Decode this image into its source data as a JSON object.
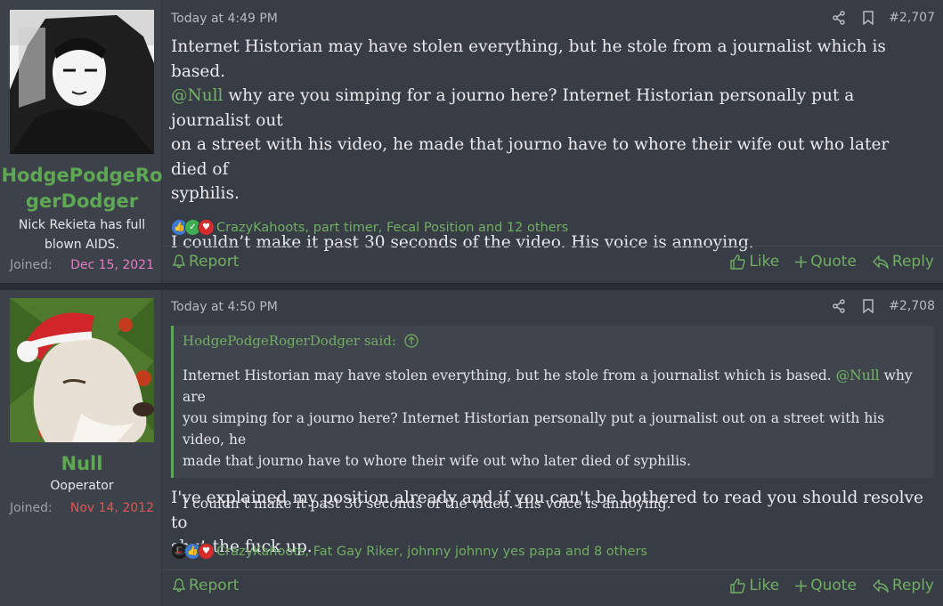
{
  "posts": [
    {
      "username": "HodgePodgeRogerDodger",
      "username_line1": "HodgePodgeRo",
      "username_line2": "gerDodger",
      "user_title_line1": "Nick Rekieta has full",
      "user_title_line2": "blown AIDS.",
      "joined_label": "Joined:",
      "joined_date": "Dec 15, 2021",
      "timestamp": "Today at 4:49 PM",
      "post_number": "#2,707",
      "body_line1": "Internet Historian may have stolen everything, but he stole from a journalist which is based.",
      "body_mention": "@Null",
      "body_line2_rest": " why are you simping for a journo here? Internet Historian personally put a journalist out",
      "body_line3": "on a street with his video, he made that journo have to whore their wife out who later died of",
      "body_line4": "syphilis.",
      "body_para2": "I couldn’t make it past 30 seconds of the video. His voice is annoying.",
      "reactions_text": "CrazyKahoots, part timer, Fecal Position and 12 others",
      "colors": {
        "username": "#5ea854",
        "joined_date": "#e07cc3"
      }
    },
    {
      "username": "Null",
      "user_title": "Ooperator",
      "joined_label": "Joined:",
      "joined_date": "Nov 14, 2012",
      "timestamp": "Today at 4:50 PM",
      "post_number": "#2,708",
      "quote_author": "HodgePodgeRogerDodger said:",
      "quote_line1": "Internet Historian may have stolen everything, but he stole from a journalist which is based.",
      "quote_mention": "@Null",
      "quote_line1_rest": " why are",
      "quote_line2": "you simping for a journo here? Internet Historian personally put a journalist out on a street with his video, he",
      "quote_line3": "made that journo have to whore their wife out who later died of syphilis.",
      "quote_para2": "I couldn’t make it past 30 seconds of the video. His voice is annoying.",
      "body_line1": "I've explained my position already and if you can't be bothered to read you should resolve to",
      "body_line2": "shut the fuck up.",
      "reactions_text": "CrazyKahoots, Fat Gay Riker, johnny johnny yes papa and 8 others",
      "colors": {
        "username": "#5ea854",
        "joined_date": "#e05555"
      }
    }
  ],
  "actions": {
    "report": "Report",
    "like": "Like",
    "quote": "Quote",
    "reply": "Reply"
  },
  "icons": [
    "share-icon",
    "bookmark-icon",
    "report-bell-icon",
    "like-thumb-icon",
    "quote-plus-icon",
    "reply-arrow-icon",
    "quote-up-arrow-icon"
  ]
}
